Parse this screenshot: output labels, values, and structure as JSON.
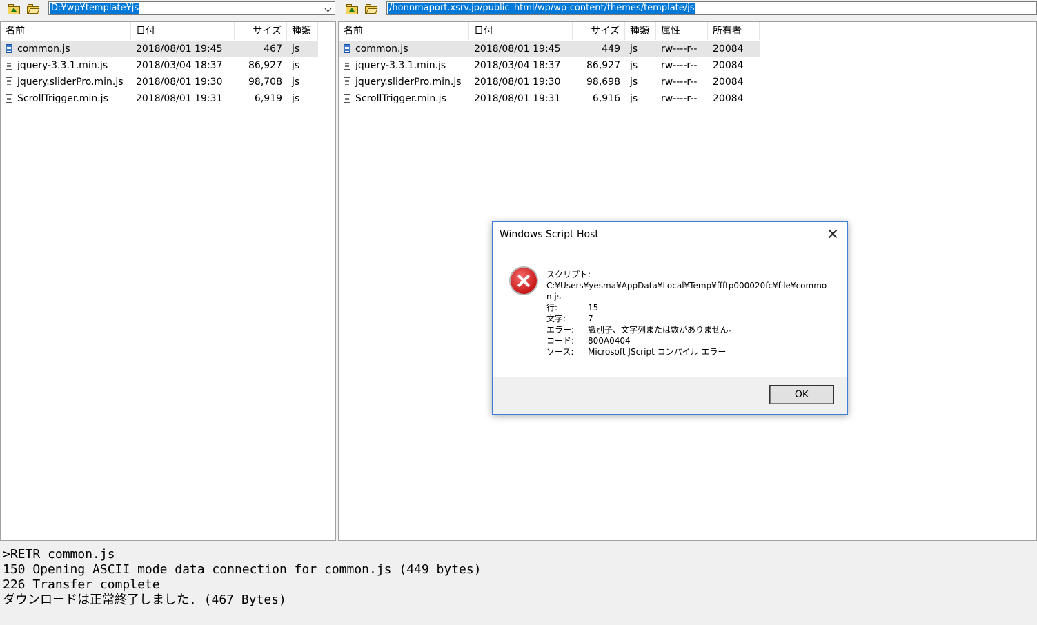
{
  "local": {
    "path": "D:¥wp¥template¥js",
    "headers": {
      "name": "名前",
      "date": "日付",
      "size": "サイズ",
      "type": "種類"
    },
    "files": [
      {
        "name": "common.js",
        "date": "2018/08/01 19:45",
        "size": "467",
        "type": "js"
      },
      {
        "name": "jquery-3.3.1.min.js",
        "date": "2018/03/04 18:37",
        "size": "86,927",
        "type": "js"
      },
      {
        "name": "jquery.sliderPro.min.js",
        "date": "2018/08/01 19:30",
        "size": "98,708",
        "type": "js"
      },
      {
        "name": "ScrollTrigger.min.js",
        "date": "2018/08/01 19:31",
        "size": "6,919",
        "type": "js"
      }
    ]
  },
  "remote": {
    "path": "/honnmaport.xsrv.jp/public_html/wp/wp-content/themes/template/js",
    "headers": {
      "name": "名前",
      "date": "日付",
      "size": "サイズ",
      "type": "種類",
      "attr": "属性",
      "owner": "所有者"
    },
    "files": [
      {
        "name": "common.js",
        "date": "2018/08/01 19:45",
        "size": "449",
        "type": "js",
        "attr": "rw----r--",
        "owner": "20084"
      },
      {
        "name": "jquery-3.3.1.min.js",
        "date": "2018/03/04 18:37",
        "size": "86,927",
        "type": "js",
        "attr": "rw----r--",
        "owner": "20084"
      },
      {
        "name": "jquery.sliderPro.min.js",
        "date": "2018/08/01 19:30",
        "size": "98,698",
        "type": "js",
        "attr": "rw----r--",
        "owner": "20084"
      },
      {
        "name": "ScrollTrigger.min.js",
        "date": "2018/08/01 19:31",
        "size": "6,916",
        "type": "js",
        "attr": "rw----r--",
        "owner": "20084"
      }
    ]
  },
  "log": [
    ">RETR common.js",
    "150 Opening ASCII mode data connection for common.js (449 bytes)",
    "226 Transfer complete",
    "ダウンロードは正常終了しました. (467 Bytes)"
  ],
  "dialog": {
    "title": "Windows Script Host",
    "script_label": "スクリプト:",
    "script_path": "C:¥Users¥yesma¥AppData¥Local¥Temp¥ffftp000020fc¥file¥common.js",
    "line_label": "行:",
    "line_value": "15",
    "char_label": "文字:",
    "char_value": "7",
    "error_label": "エラー:",
    "error_value": "識別子、文字列または数がありません。",
    "code_label": "コード:",
    "code_value": "800A0404",
    "source_label": "ソース:",
    "source_value": "Microsoft JScript コンパイル エラー",
    "ok_label": "OK"
  },
  "colors": {
    "selection": "#0078d7",
    "dialog_border": "#3c7fd8",
    "error_icon": "#c81818"
  }
}
